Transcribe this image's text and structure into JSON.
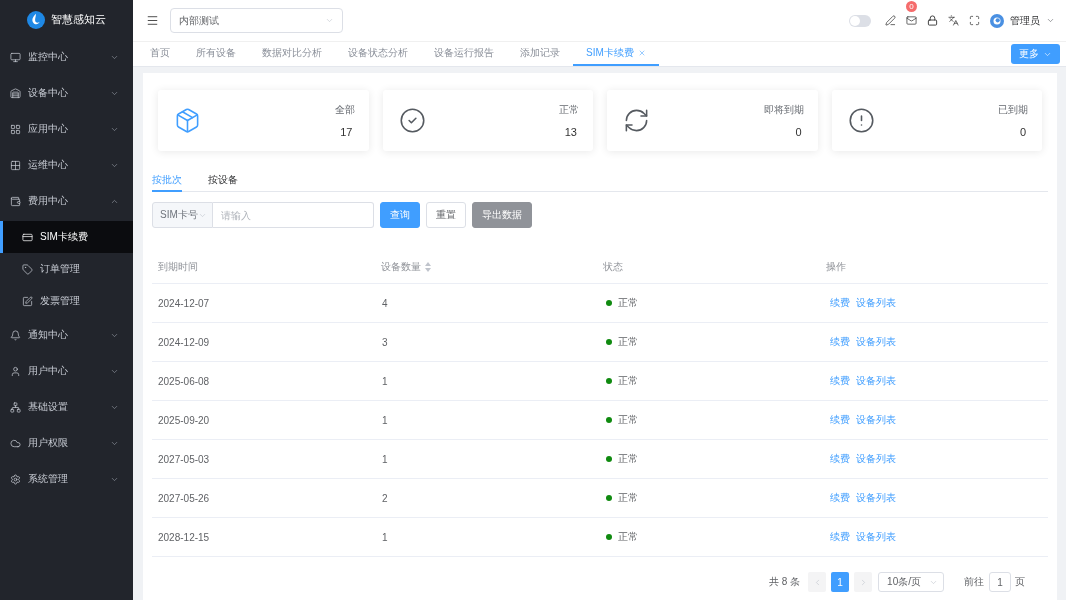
{
  "sidebar": {
    "logo_text": "智慧感知云",
    "items": [
      {
        "label": "监控中心",
        "expanded": false
      },
      {
        "label": "设备中心",
        "expanded": false
      },
      {
        "label": "应用中心",
        "expanded": false
      },
      {
        "label": "运维中心",
        "expanded": false
      },
      {
        "label": "费用中心",
        "expanded": true,
        "children": [
          {
            "label": "SIM卡续费",
            "selected": true
          },
          {
            "label": "订单管理",
            "selected": false
          },
          {
            "label": "发票管理",
            "selected": false
          }
        ]
      },
      {
        "label": "通知中心",
        "expanded": false
      },
      {
        "label": "用户中心",
        "expanded": false
      },
      {
        "label": "基础设置",
        "expanded": false
      },
      {
        "label": "用户权限",
        "expanded": false
      },
      {
        "label": "系统管理",
        "expanded": false
      }
    ]
  },
  "header": {
    "tenant_select": {
      "value": "内部测试"
    },
    "theme_toggle": {
      "on": false
    },
    "mail_badge": "0",
    "user_name": "管理员"
  },
  "page_tabs": {
    "tabs": [
      {
        "label": "首页",
        "selected": false,
        "closable": false
      },
      {
        "label": "所有设备",
        "selected": false,
        "closable": false
      },
      {
        "label": "数据对比分析",
        "selected": false,
        "closable": false
      },
      {
        "label": "设备状态分析",
        "selected": false,
        "closable": false
      },
      {
        "label": "设备运行报告",
        "selected": false,
        "closable": false
      },
      {
        "label": "添加记录",
        "selected": false,
        "closable": false
      },
      {
        "label": "SIM卡续费",
        "selected": true,
        "closable": true
      }
    ],
    "more_button": "更多"
  },
  "stat_cards": [
    {
      "label": "全部",
      "value": "17",
      "selected": true
    },
    {
      "label": "正常",
      "value": "13",
      "selected": false
    },
    {
      "label": "即将到期",
      "value": "0",
      "selected": false
    },
    {
      "label": "已到期",
      "value": "0",
      "selected": false
    }
  ],
  "view_tabs": [
    {
      "label": "按批次",
      "selected": true
    },
    {
      "label": "按设备",
      "selected": false
    }
  ],
  "filter": {
    "field_select": {
      "value": "SIM卡号"
    },
    "search": {
      "placeholder": "请输入"
    },
    "buttons": [
      {
        "label": "查询",
        "kind": "primary"
      },
      {
        "label": "重置",
        "kind": "default"
      },
      {
        "label": "导出数据",
        "kind": "info"
      }
    ]
  },
  "table": {
    "columns": [
      {
        "label": "到期时间",
        "sortable": false
      },
      {
        "label": "设备数量",
        "sortable": true
      },
      {
        "label": "状态",
        "sortable": false
      },
      {
        "label": "操作",
        "sortable": false
      }
    ],
    "rows": [
      {
        "expiry": "2024-12-07",
        "count": "4",
        "status": {
          "label": "正常",
          "color": "#0f8a0f"
        },
        "actions": [
          "续费",
          "设备列表"
        ]
      },
      {
        "expiry": "2024-12-09",
        "count": "3",
        "status": {
          "label": "正常",
          "color": "#0f8a0f"
        },
        "actions": [
          "续费",
          "设备列表"
        ]
      },
      {
        "expiry": "2025-06-08",
        "count": "1",
        "status": {
          "label": "正常",
          "color": "#0f8a0f"
        },
        "actions": [
          "续费",
          "设备列表"
        ]
      },
      {
        "expiry": "2025-09-20",
        "count": "1",
        "status": {
          "label": "正常",
          "color": "#0f8a0f"
        },
        "actions": [
          "续费",
          "设备列表"
        ]
      },
      {
        "expiry": "2027-05-03",
        "count": "1",
        "status": {
          "label": "正常",
          "color": "#0f8a0f"
        },
        "actions": [
          "续费",
          "设备列表"
        ]
      },
      {
        "expiry": "2027-05-26",
        "count": "2",
        "status": {
          "label": "正常",
          "color": "#0f8a0f"
        },
        "actions": [
          "续费",
          "设备列表"
        ]
      },
      {
        "expiry": "2028-12-15",
        "count": "1",
        "status": {
          "label": "正常",
          "color": "#0f8a0f"
        },
        "actions": [
          "续费",
          "设备列表"
        ]
      }
    ]
  },
  "pagination": {
    "total": "共 8 条",
    "prev_disabled": true,
    "next_disabled": true,
    "pages": [
      {
        "label": "1",
        "selected": true
      }
    ],
    "page_size": "10条/页",
    "goto_label": "前往",
    "goto_value": "1",
    "goto_suffix": "页"
  }
}
